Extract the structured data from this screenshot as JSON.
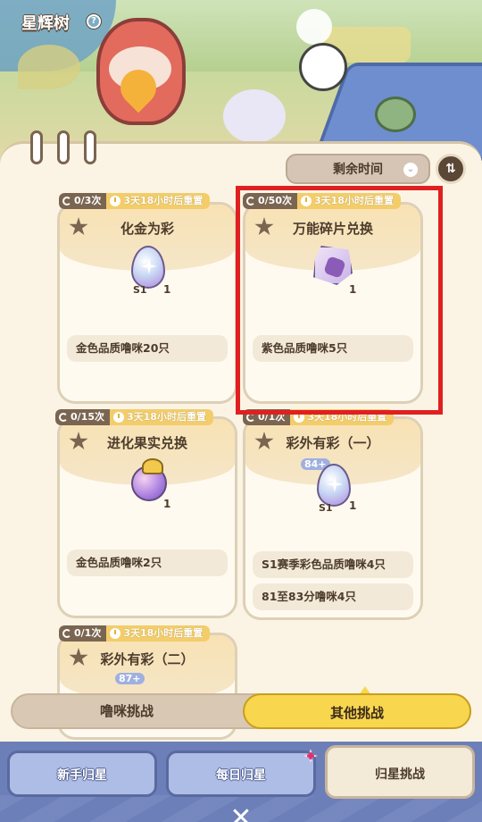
{
  "header": {
    "title": "星辉树",
    "help_icon": "?"
  },
  "filter": {
    "label": "剩余时间",
    "chevron": "⌄"
  },
  "sort_icon": "⇅",
  "cards": [
    {
      "count": "0/3次",
      "time": "3天18小时后重置",
      "name": "化金为彩",
      "qty": "1",
      "tag": "S1",
      "conditions": [
        "金色品质噜咪20只"
      ]
    },
    {
      "count": "0/50次",
      "time": "3天18小时后重置",
      "name": "万能碎片兑换",
      "qty": "1",
      "conditions": [
        "紫色品质噜咪5只"
      ]
    },
    {
      "count": "0/15次",
      "time": "3天18小时后重置",
      "name": "进化果实兑换",
      "qty": "1",
      "conditions": [
        "金色品质噜咪2只"
      ]
    },
    {
      "count": "0/1次",
      "time": "3天18小时后重置",
      "name": "彩外有彩（一）",
      "qty": "1",
      "tag": "S1",
      "level_badge": "84+",
      "conditions": [
        "S1赛季彩色品质噜咪4只",
        "81至83分噜咪4只"
      ]
    },
    {
      "count": "0/1次",
      "time": "3天18小时后重置",
      "name": "彩外有彩（二）",
      "level_badge": "87+"
    }
  ],
  "challenge_tabs": {
    "left": "噜咪挑战",
    "right": "其他挑战"
  },
  "nav": {
    "novice": "新手归星",
    "daily": "每日归星",
    "challenge": "归星挑战"
  },
  "close_icon": "✕"
}
